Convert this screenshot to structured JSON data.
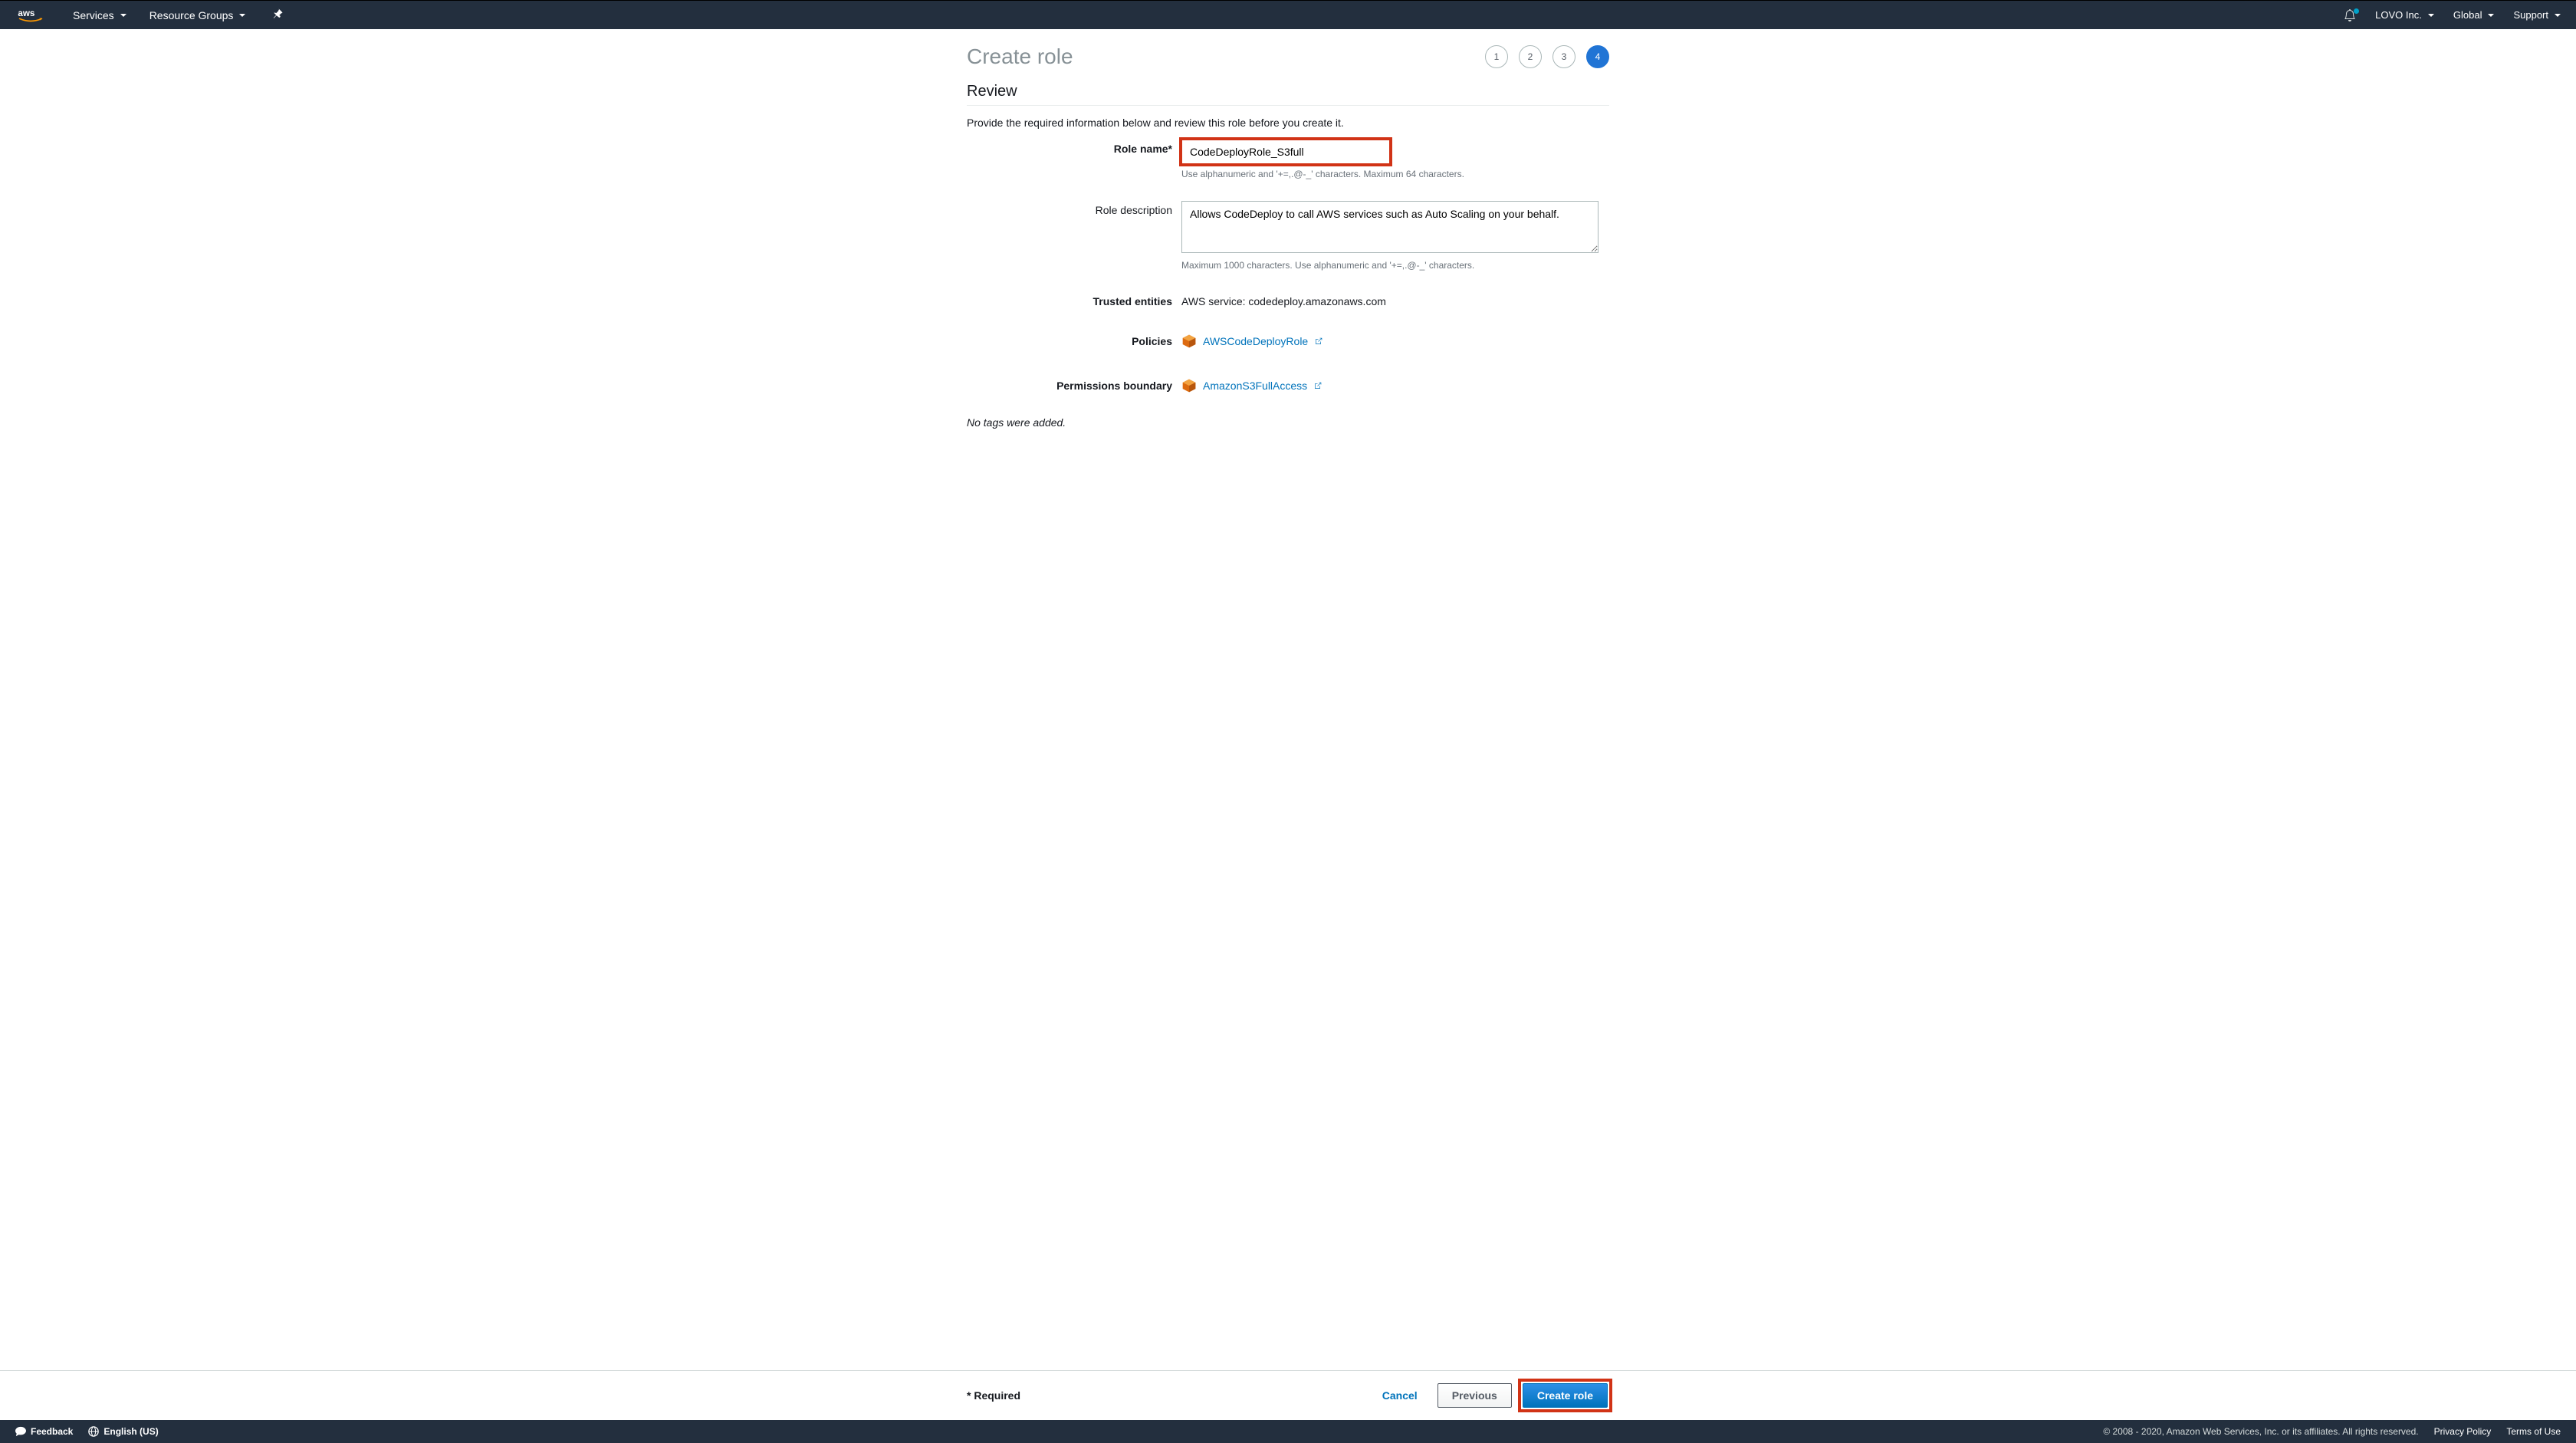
{
  "nav": {
    "services": "Services",
    "resource_groups": "Resource Groups",
    "account": "LOVO Inc.",
    "region": "Global",
    "support": "Support"
  },
  "page": {
    "title": "Create role",
    "steps": [
      "1",
      "2",
      "3",
      "4"
    ],
    "active_step": 3
  },
  "review": {
    "heading": "Review",
    "intro": "Provide the required information below and review this role before you create it.",
    "role_name_label": "Role name*",
    "role_name_value": "CodeDeployRole_S3full",
    "role_name_hint": "Use alphanumeric and '+=,.@-_' characters. Maximum 64 characters.",
    "role_desc_label": "Role description",
    "role_desc_value": "Allows CodeDeploy to call AWS services such as Auto Scaling on your behalf.",
    "role_desc_hint": "Maximum 1000 characters. Use alphanumeric and '+=,.@-_' characters.",
    "trusted_label": "Trusted entities",
    "trusted_value": "AWS service: codedeploy.amazonaws.com",
    "policies_label": "Policies",
    "policies": [
      {
        "name": "AWSCodeDeployRole"
      }
    ],
    "boundary_label": "Permissions boundary",
    "boundary": [
      {
        "name": "AmazonS3FullAccess"
      }
    ],
    "no_tags": "No tags were added."
  },
  "actions": {
    "required": "* Required",
    "cancel": "Cancel",
    "previous": "Previous",
    "create": "Create role"
  },
  "footer": {
    "feedback": "Feedback",
    "language": "English (US)",
    "copyright": "© 2008 - 2020, Amazon Web Services, Inc. or its affiliates. All rights reserved.",
    "privacy": "Privacy Policy",
    "terms": "Terms of Use"
  }
}
